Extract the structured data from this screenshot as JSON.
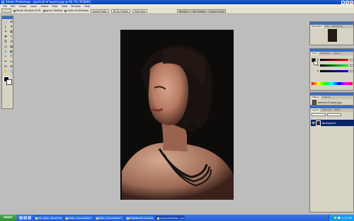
{
  "window": {
    "title": "Adobe Photoshop - [portrait of kaylen.jpg @ 66.7% (RGB/8)]"
  },
  "menu": [
    "File",
    "Edit",
    "Image",
    "Layer",
    "Select",
    "Filter",
    "View",
    "Window",
    "Help"
  ],
  "options": {
    "resize_windows_label": "Resize Windows To Fit",
    "ignore_palettes_label": "Ignore Palettes",
    "zoom_all_label": "Zoom All Windows",
    "actual_pixels_label": "Actual Pixels",
    "fit_on_screen_label": "Fit On Screen",
    "print_size_label": "Print Size"
  },
  "palette_well": {
    "tabs": [
      "Brushes",
      "Tool Presets",
      "Layer Comps"
    ]
  },
  "toolbox": {
    "tools": [
      {
        "glyph": "⬚",
        "name": "marquee-tool"
      },
      {
        "glyph": "➤",
        "name": "move-tool"
      },
      {
        "glyph": "ʆ",
        "name": "lasso-tool"
      },
      {
        "glyph": "✦",
        "name": "magic-wand-tool"
      },
      {
        "glyph": "⌗",
        "name": "crop-tool"
      },
      {
        "glyph": "⧉",
        "name": "slice-tool"
      },
      {
        "glyph": "✚",
        "name": "healing-brush-tool"
      },
      {
        "glyph": "✎",
        "name": "brush-tool"
      },
      {
        "glyph": "⎘",
        "name": "clone-stamp-tool"
      },
      {
        "glyph": "↺",
        "name": "history-brush-tool"
      },
      {
        "glyph": "◫",
        "name": "eraser-tool"
      },
      {
        "glyph": "▤",
        "name": "gradient-tool"
      },
      {
        "glyph": "💧",
        "name": "blur-tool"
      },
      {
        "glyph": "◐",
        "name": "dodge-tool"
      },
      {
        "glyph": "↖",
        "name": "path-selection-tool"
      },
      {
        "glyph": "T",
        "name": "type-tool"
      },
      {
        "glyph": "✒",
        "name": "pen-tool"
      },
      {
        "glyph": "▭",
        "name": "shape-tool"
      },
      {
        "glyph": "✉",
        "name": "notes-tool"
      },
      {
        "glyph": "⊕",
        "name": "eyedropper-tool"
      },
      {
        "glyph": "✋",
        "name": "hand-tool"
      },
      {
        "glyph": "🔍",
        "name": "zoom-tool"
      }
    ]
  },
  "navigator": {
    "tabs": [
      "Navigator",
      "Info",
      "Histogram"
    ]
  },
  "color": {
    "tabs": [
      "Color",
      "Swatches",
      "Styles"
    ],
    "slider_labels": [
      "R",
      "G",
      "B"
    ]
  },
  "history": {
    "tabs": [
      "History",
      "Actions"
    ],
    "snapshot": "portrait of kaylen.jpg",
    "state": "Image Size"
  },
  "layers": {
    "tabs": [
      "Layers",
      "Channels",
      "Paths"
    ],
    "layer_name": "Background"
  },
  "taskbar": {
    "start_label": "start",
    "tasks": [
      {
        "label": "2G. 1(Ally - By Par To Go...",
        "active": false
      },
      {
        "label": "Justin - Conversation",
        "active": false
      },
      {
        "label": "Mike - Conversation",
        "active": false
      },
      {
        "label": "Hotel/Reader previews Gi...",
        "active": false
      },
      {
        "label": "Adobe Photoshop - [po...",
        "active": true
      }
    ],
    "clock": "1:12 PM"
  },
  "colors": {
    "accent": "#0a246a",
    "titlebar": "#1a5fd8",
    "workspace": "#bdbdbd"
  }
}
